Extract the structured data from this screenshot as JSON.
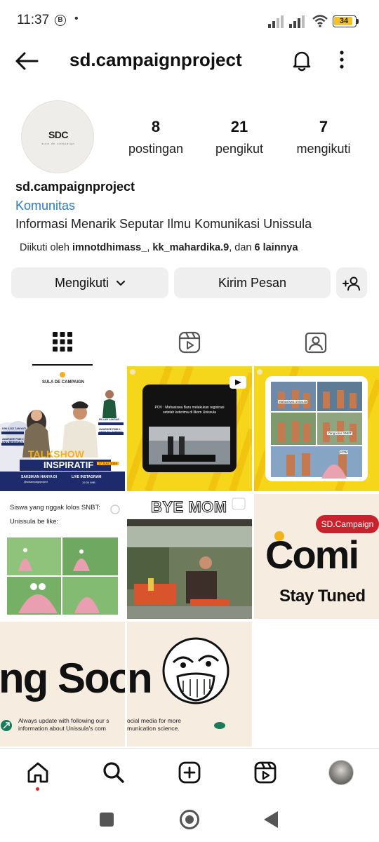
{
  "status_bar": {
    "time": "11:37",
    "badge": "B",
    "dot": "•",
    "battery": "34"
  },
  "header": {
    "username": "sd.campaignproject"
  },
  "profile": {
    "avatar_text": "SDC",
    "avatar_subtext": "sula de campaign",
    "stats": [
      {
        "value": "8",
        "label": "postingan"
      },
      {
        "value": "21",
        "label": "pengikut"
      },
      {
        "value": "7",
        "label": "mengikuti"
      }
    ],
    "name": "sd.campaignproject",
    "category": "Komunitas",
    "bio": "Informasi Menarik Seputar Ilmu Komunikasi Unissula",
    "followed_prefix": "Diikuti oleh ",
    "followed_user1": "imnotdhimass_",
    "followed_sep": ", ",
    "followed_user2": "kk_mahardika.9",
    "followed_mid": ", dan ",
    "followed_more": "6 lainnya"
  },
  "actions": {
    "follow_label": "Mengikuti",
    "message_label": "Kirim Pesan"
  },
  "tabs": [
    "grid-posts",
    "reels",
    "tagged"
  ],
  "posts": {
    "p1": {
      "brand": "SULA DE CAMPAIGN",
      "title1": "TALKSHOW",
      "title2": "INSPIRATIF",
      "date": "17 JULI 2024",
      "left_caption": "SAKSIKAN HANYA DI",
      "left_sub": "@sdcampaignproject",
      "right_caption": "LIVE INSTAGRAM",
      "right_sub": "19.30 WIB",
      "badge1": "DINI AZIZI ZAKIYATI",
      "badge2": "AWARDEE PMM 4 UNIV BENGKULU",
      "badge3": "PILLAR LAKSAR",
      "badge4": "AWARDEE PMM 4 UNIMUDA SORONG"
    },
    "p2": {
      "caption": "POV : Mahasiswa Baru melakukan registrasi setelah keterima di Ilkom Unissula"
    },
    "p3": {
      "labels": [
        "Mahasiswa unissula",
        "Yang lolos SNBT",
        "KOM"
      ]
    },
    "p4": {
      "line1": "Siswa yang nggak lolos SNBT:",
      "line2": "Unissula be like:"
    },
    "p5": {
      "caption": "BYE MOM"
    },
    "p6": {
      "badge": "SD.Campaign",
      "word": "Comi",
      "sub": "Stay Tuned"
    },
    "p7": {
      "word": "ng Soon",
      "note1": "Always update with following our s",
      "note2": "information about Unissula's com"
    },
    "p8": {
      "word": "n",
      "note1": "ocial media for more",
      "note2": "munication science."
    }
  },
  "bottom_nav": [
    "home-icon",
    "search-icon",
    "create-icon",
    "reels-icon",
    "profile-avatar"
  ],
  "colors": {
    "link": "#2a79c3",
    "button_bg": "#efefef",
    "post_yellow": "#f6d61b",
    "post_cream": "#f6ecdf",
    "post_navy": "#1d2a6b"
  }
}
